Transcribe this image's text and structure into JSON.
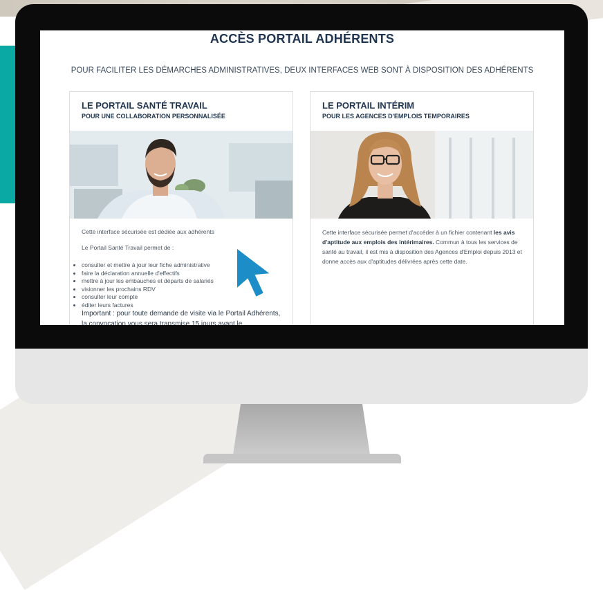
{
  "page": {
    "title": "ACCÈS PORTAIL ADHÉRENTS",
    "subtitle": "POUR FACILITER LES DÉMARCHES ADMINISTRATIVES, DEUX INTERFACES WEB SONT À DISPOSITION DES ADHÉRENTS"
  },
  "cards": [
    {
      "title": "LE PORTAIL SANTÉ TRAVAIL",
      "subtitle": "POUR UNE COLLABORATION PERSONNALISÉE",
      "intro": "Cette interface sécurisée est dédiée aux adhérents",
      "list_heading": "Le Portail Santé Travail permet de :",
      "items": [
        "consulter et mettre à jour leur fiche administrative",
        "faire la déclaration annuelle d'effectifs",
        "mettre à jour les embauches et départs de salariés",
        "visionner les prochains RDV",
        "consulter leur compte",
        "éditer leurs factures"
      ],
      "important": "Important : pour toute demande de visite via le Portail Adhérents, la convocation vous sera transmise 15 jours avant le"
    },
    {
      "title": "LE PORTAIL INTÉRIM",
      "subtitle": "POUR LES AGENCES D'EMPLOIS TEMPORAIRES",
      "intro_a": "Cette interface sécurisée permet d'accéder à un fichier contenant ",
      "intro_bold": "les avis d'aptitude aux emplois des intérimaires.",
      "intro_b": " Commun à tous les services de santé au travail, il est mis à disposition des Agences d'Emploi depuis 2013 et donne accès aux d'aptitudes délivrées après cette date."
    }
  ],
  "colors": {
    "accent_teal": "#0ba9a4",
    "cursor_blue": "#1d8dc7",
    "heading_navy": "#1f3550"
  },
  "icons": {
    "cursor": "arrow-cursor-icon"
  }
}
